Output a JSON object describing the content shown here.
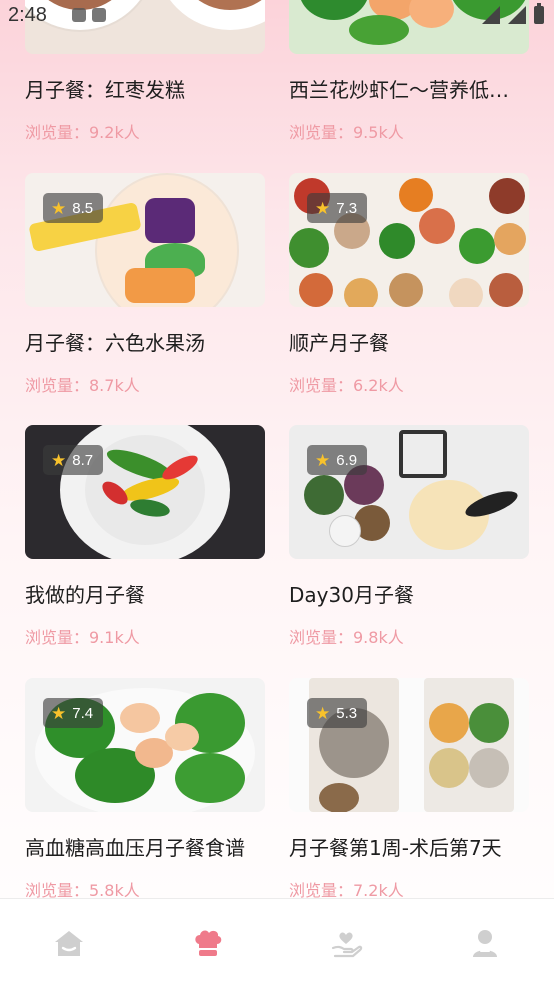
{
  "status_bar": {
    "time": "2:48"
  },
  "recipes": [
    {
      "title": "月子餐：红枣发糕",
      "views": "浏览量：9.2k人",
      "rating": ""
    },
    {
      "title": "西兰花炒虾仁～营养低…",
      "views": "浏览量：9.5k人",
      "rating": ""
    },
    {
      "title": "月子餐：六色水果汤",
      "views": "浏览量：8.7k人",
      "rating": "8.5"
    },
    {
      "title": "顺产月子餐",
      "views": "浏览量：6.2k人",
      "rating": "7.3"
    },
    {
      "title": "我做的月子餐",
      "views": "浏览量：9.1k人",
      "rating": "8.7"
    },
    {
      "title": "Day30月子餐",
      "views": "浏览量：9.8k人",
      "rating": "6.9"
    },
    {
      "title": "高血糖高血压月子餐食谱",
      "views": "浏览量：5.8k人",
      "rating": "7.4"
    },
    {
      "title": "月子餐第1周-术后第7天",
      "views": "浏览量：7.2k人",
      "rating": "5.3"
    }
  ],
  "nav": [
    {
      "name": "home",
      "icon": "house-icon",
      "active": false
    },
    {
      "name": "recipes",
      "icon": "chef-hat-icon",
      "active": true
    },
    {
      "name": "care",
      "icon": "heart-hand-icon",
      "active": false
    },
    {
      "name": "profile",
      "icon": "person-icon",
      "active": false
    }
  ],
  "colors": {
    "accent": "#ef7a8a",
    "views_text": "#ef9aa4",
    "nav_inactive": "#cfcfcf"
  }
}
